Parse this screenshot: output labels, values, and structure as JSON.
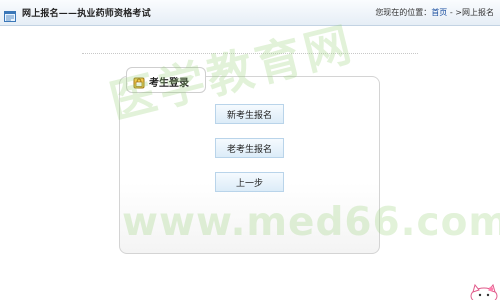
{
  "header": {
    "title": "网上报名——执业药师资格考试",
    "breadcrumb_prefix": "您现在的位置：",
    "breadcrumb_home": "首页",
    "breadcrumb_sep": " - >",
    "breadcrumb_current": "网上报名",
    "icon": "form-icon"
  },
  "panel": {
    "tab_label": "考生登录",
    "tab_icon": "lock-icon",
    "buttons": {
      "new_student": "新考生报名",
      "old_student": "老考生报名",
      "back": "上一步"
    }
  },
  "watermark": {
    "chinese": "医学教育网",
    "url": "www.med66.com"
  },
  "colors": {
    "header_bg": "#e6eef6",
    "button_bg": "#dcecf8",
    "button_border": "#b9d4ea",
    "link": "#1a4fa0",
    "watermark": "#96d278"
  }
}
